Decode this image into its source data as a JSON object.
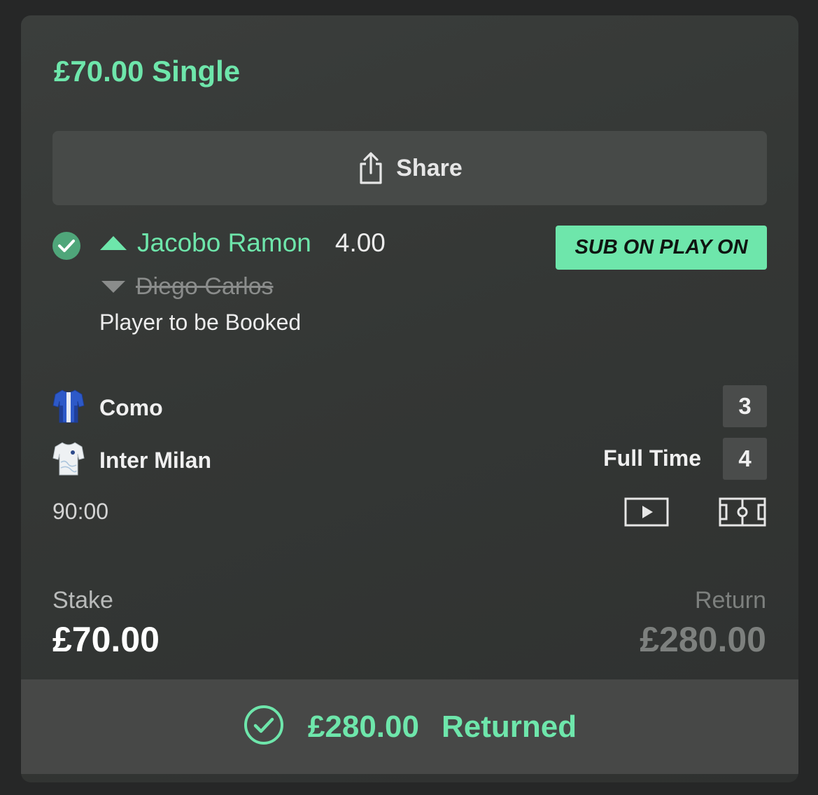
{
  "bet": {
    "title": "£70.00 Single",
    "share_label": "Share",
    "selection": {
      "player_in": "Jacobo Ramon",
      "odds": "4.00",
      "player_out": "Diego Carlos",
      "market": "Player to be Booked",
      "badge": "SUB ON PLAY ON"
    },
    "match": {
      "home_team": "Como",
      "away_team": "Inter Milan",
      "home_score": "3",
      "away_score": "4",
      "status": "Full Time",
      "clock": "90:00"
    },
    "stake_label": "Stake",
    "stake_value": "£70.00",
    "return_label": "Return",
    "return_value": "£280.00",
    "footer": {
      "amount": "£280.00",
      "status": "Returned"
    }
  },
  "colors": {
    "accent": "#6ee6ab",
    "card_bg": "#363937",
    "check_badge": "#4fa67a",
    "muted": "#7d807e"
  },
  "icons": [
    "share-icon",
    "check-icon",
    "arrow-up-icon",
    "arrow-down-icon",
    "home-kit-icon",
    "away-kit-icon",
    "video-icon",
    "pitch-icon",
    "returned-check-icon"
  ]
}
